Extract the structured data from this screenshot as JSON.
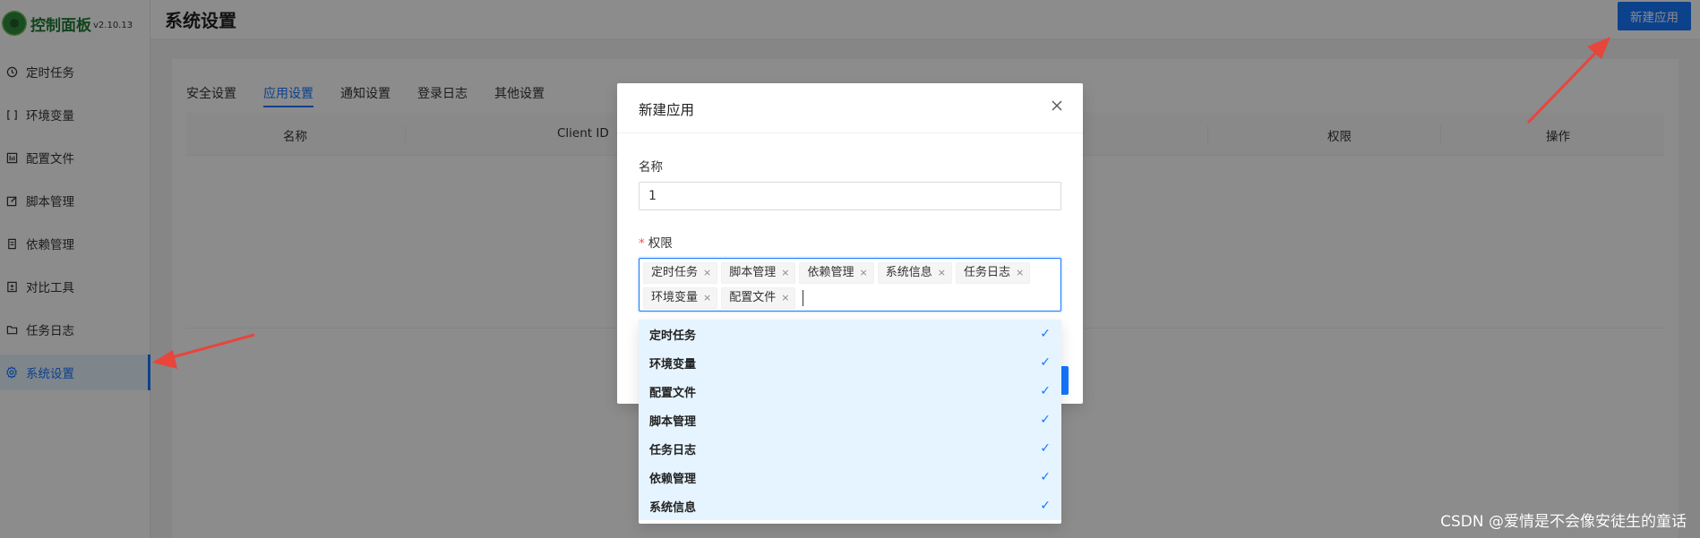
{
  "app": {
    "title": "控制面板",
    "version": "v2.10.13"
  },
  "sidebar": {
    "items": [
      {
        "label": "定时任务",
        "icon": "clock-icon"
      },
      {
        "label": "环境变量",
        "icon": "variable-icon"
      },
      {
        "label": "配置文件",
        "icon": "config-icon"
      },
      {
        "label": "脚本管理",
        "icon": "edit-icon"
      },
      {
        "label": "依赖管理",
        "icon": "package-icon"
      },
      {
        "label": "对比工具",
        "icon": "diff-icon"
      },
      {
        "label": "任务日志",
        "icon": "folder-icon"
      },
      {
        "label": "系统设置",
        "icon": "gear-icon",
        "active": true
      }
    ]
  },
  "header": {
    "title": "系统设置",
    "new_app_button": "新建应用"
  },
  "tabs": [
    "安全设置",
    "应用设置",
    "通知设置",
    "登录日志",
    "其他设置"
  ],
  "active_tab": "应用设置",
  "table": {
    "columns": [
      "名称",
      "Client ID",
      "权限",
      "操作"
    ]
  },
  "modal": {
    "title": "新建应用",
    "name_label": "名称",
    "name_value": "1",
    "permission_label": "权限",
    "required_mark": "*",
    "selected_tags": [
      "定时任务",
      "脚本管理",
      "依赖管理",
      "系统信息",
      "任务日志",
      "环境变量",
      "配置文件"
    ],
    "tag_remove_glyph": "×"
  },
  "dropdown": {
    "options": [
      "定时任务",
      "环境变量",
      "配置文件",
      "脚本管理",
      "任务日志",
      "依赖管理",
      "系统信息"
    ],
    "check_glyph": "✓"
  },
  "watermark": "CSDN @爱情是不会像安徒生的童话",
  "colors": {
    "primary": "#1677ff",
    "annotation_arrow": "#e8453c",
    "option_bg": "#e6f4ff"
  }
}
